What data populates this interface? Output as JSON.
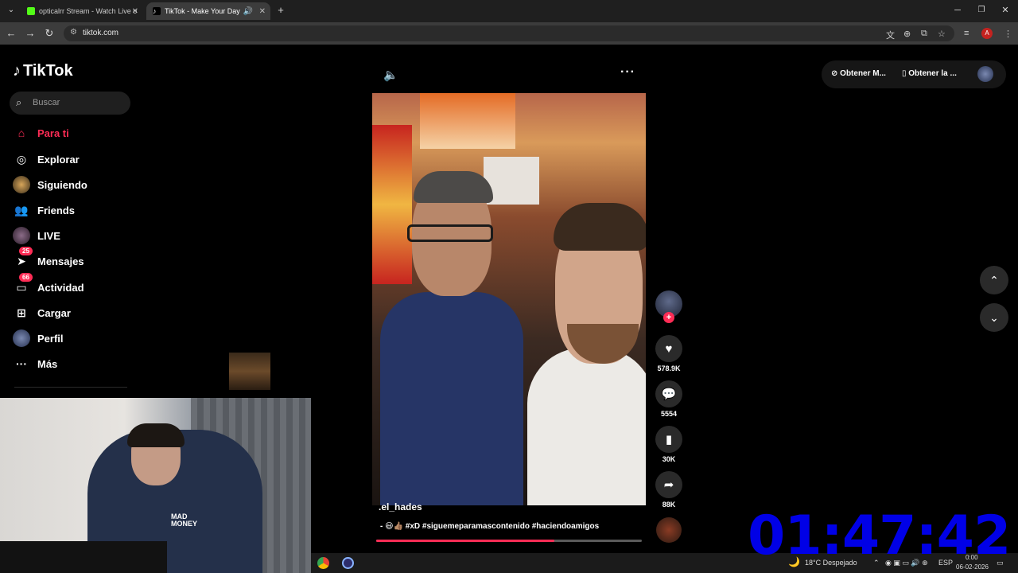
{
  "browser": {
    "tabs": [
      {
        "title": "opticalrr Stream - Watch Live o",
        "favicon_color": "#53fc18"
      },
      {
        "title": "TikTok - Make Your Day",
        "favicon_color": "#ffffff"
      }
    ],
    "address": "tiktok.com"
  },
  "tiktok": {
    "logo_text": "TikTok",
    "search_placeholder": "Buscar",
    "nav": [
      {
        "label": "Para ti",
        "icon": "home-icon",
        "active": true
      },
      {
        "label": "Explorar",
        "icon": "compass-icon"
      },
      {
        "label": "Siguiendo",
        "icon": "avatar-icon"
      },
      {
        "label": "Friends",
        "icon": "friends-icon"
      },
      {
        "label": "LIVE",
        "icon": "live-avatar-icon"
      },
      {
        "label": "Mensajes",
        "icon": "send-icon",
        "badge": "25"
      },
      {
        "label": "Actividad",
        "icon": "inbox-icon",
        "badge": "66"
      },
      {
        "label": "Cargar",
        "icon": "plus-square-icon"
      },
      {
        "label": "Perfil",
        "icon": "profile-avatar-icon"
      },
      {
        "label": "Más",
        "icon": "ellipsis-icon"
      }
    ],
    "video": {
      "author": ".el_hades",
      "caption": "- 😃👍🏽 #xD #siguemeparamascontenido #haciendoamigos",
      "progress": 0.67
    },
    "actions": {
      "likes": "578.9K",
      "comments": "5554",
      "saves": "30K",
      "shares": "88K"
    },
    "top_right": {
      "btn1": "Obtener M...",
      "btn2": "Obtener la ..."
    },
    "accent": "#fe2c55"
  },
  "webcam": {
    "shirt_text": "MAD MONEY"
  },
  "overlay": {
    "timer": "01:47:42"
  },
  "taskbar": {
    "weather": "18°C  Despejado",
    "lang": "ESP",
    "time": "0:00",
    "date": "06-02-2026"
  }
}
